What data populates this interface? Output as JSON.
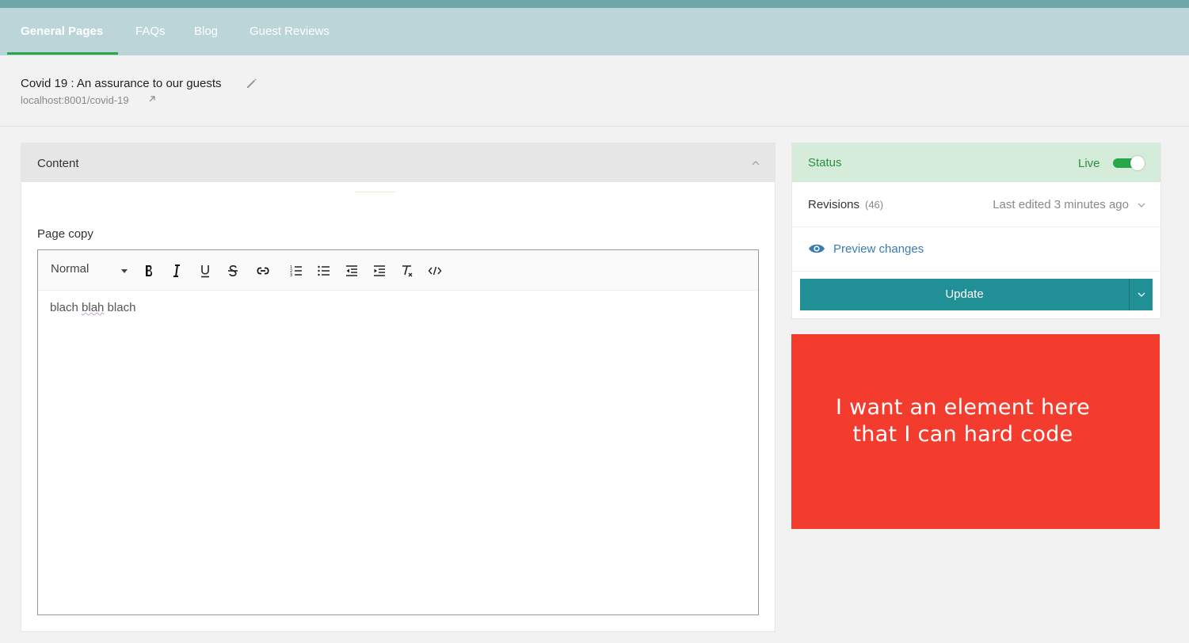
{
  "nav": {
    "tabs": [
      {
        "label": "General Pages",
        "active": true
      },
      {
        "label": "FAQs",
        "active": false
      },
      {
        "label": "Blog",
        "active": false
      },
      {
        "label": "Guest Reviews",
        "active": false
      }
    ]
  },
  "page": {
    "title": "Covid 19 : An assurance to our guests",
    "url": "localhost:8001/covid-19"
  },
  "content": {
    "header": "Content",
    "field_label": "Page copy",
    "editor": {
      "format": "Normal",
      "text_before": "blach ",
      "text_misspelled": "blah",
      "text_after": " blach"
    }
  },
  "status": {
    "title": "Status",
    "live_label": "Live",
    "live": true,
    "revisions_label": "Revisions",
    "revisions_count": "(46)",
    "last_edited": "Last edited 3 minutes ago",
    "preview_label": "Preview changes",
    "update_label": "Update"
  },
  "promo": {
    "line1": "I want an element here",
    "line2": "that I can hard code",
    "color": "#f33c2e"
  },
  "colors": {
    "accent": "#218f96",
    "live_green": "#2aa64a",
    "link_blue": "#3b7bb3"
  }
}
